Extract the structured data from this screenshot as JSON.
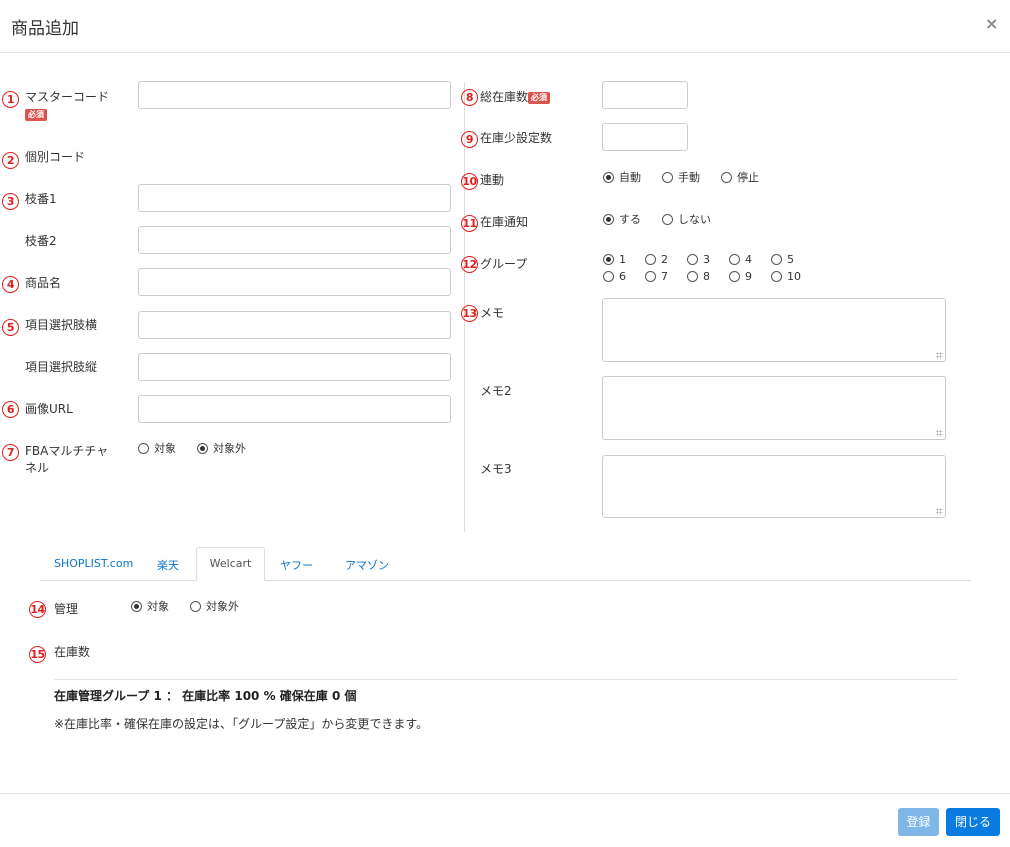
{
  "header": {
    "title": "商品追加",
    "close_label": "×"
  },
  "left": {
    "master_code": {
      "num": "1",
      "label": "マスターコード",
      "required": "必須"
    },
    "individual_code": {
      "num": "2",
      "label": "個別コード"
    },
    "branch1": {
      "num": "3",
      "label": "枝番1"
    },
    "branch2": {
      "label": "枝番2"
    },
    "product_name": {
      "num": "4",
      "label": "商品名"
    },
    "option_h": {
      "num": "5",
      "label": "項目選択肢横"
    },
    "option_v": {
      "label": "項目選択肢縦"
    },
    "image_url": {
      "num": "6",
      "label": "画像URL"
    },
    "fba": {
      "num": "7",
      "label": "FBAマルチチャネル",
      "options": [
        "対象",
        "対象外"
      ],
      "selected": 1
    }
  },
  "right": {
    "total_stock": {
      "num": "8",
      "label": "総在庫数",
      "required": "必須"
    },
    "low_stock": {
      "num": "9",
      "label": "在庫少設定数"
    },
    "link": {
      "num": "10",
      "label": "連動",
      "options": [
        "自動",
        "手動",
        "停止"
      ],
      "selected": 0
    },
    "stock_notify": {
      "num": "11",
      "label": "在庫通知",
      "options": [
        "する",
        "しない"
      ],
      "selected": 0
    },
    "group": {
      "num": "12",
      "label": "グループ",
      "options": [
        "1",
        "2",
        "3",
        "4",
        "5",
        "6",
        "7",
        "8",
        "9",
        "10"
      ],
      "selected": 0
    },
    "memo": {
      "num": "13",
      "label": "メモ"
    },
    "memo2": {
      "label": "メモ2"
    },
    "memo3": {
      "label": "メモ3"
    }
  },
  "tabs": {
    "items": [
      "SHOPLIST.com",
      "楽天",
      "Welcart",
      "ヤフー",
      "アマゾン"
    ],
    "active": 2
  },
  "tab_panel": {
    "manage": {
      "num": "14",
      "label": "管理",
      "options": [
        "対象",
        "対象外"
      ],
      "selected": 0
    },
    "stock": {
      "num": "15",
      "label": "在庫数"
    },
    "summary": "在庫管理グループ 1 ： 在庫比率 100 % 確保在庫 0 個",
    "note": "※在庫比率・確保在庫の設定は、「グループ設定」から変更できます。"
  },
  "footer": {
    "register_label": "登録",
    "close_label": "閉じる"
  },
  "colors": {
    "accent": "#0a74c9",
    "required_badge": "#d9534f",
    "number_circle": "#e02020",
    "register_btn": "#7fb6e8",
    "close_btn": "#0a7be0"
  }
}
